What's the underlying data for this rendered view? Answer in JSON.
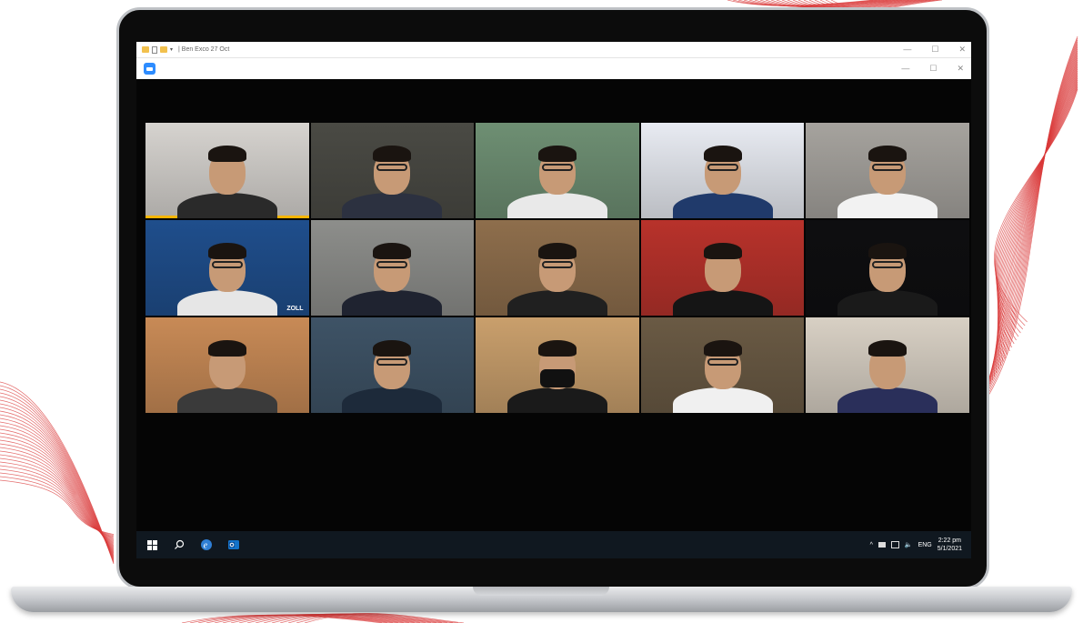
{
  "explorer": {
    "path_text": "| Ben Exco 27 Oct",
    "minimize": "—",
    "maximize": "☐",
    "close": "✕"
  },
  "zoom": {
    "minimize": "—",
    "maximize": "☐",
    "close": "✕"
  },
  "participants": [
    {
      "bg": "#d6d3cf",
      "shirt": "#2a2a2a",
      "glasses": false,
      "mask": false,
      "active": true
    },
    {
      "bg": "#4a4a44",
      "shirt": "#2c3140",
      "glasses": true,
      "mask": false,
      "active": false
    },
    {
      "bg": "#6e8f73",
      "shirt": "#e9e9e9",
      "glasses": true,
      "mask": false,
      "active": false
    },
    {
      "bg": "#e8ebf2",
      "shirt": "#203a6b",
      "glasses": true,
      "mask": false,
      "active": false
    },
    {
      "bg": "#a6a39e",
      "shirt": "#f2f2f2",
      "glasses": true,
      "mask": false,
      "active": false
    },
    {
      "bg": "#1f4e8c",
      "shirt": "#e6e6e6",
      "glasses": true,
      "mask": false,
      "active": false,
      "label": "ZOLL"
    },
    {
      "bg": "#8d8e8b",
      "shirt": "#1f2330",
      "glasses": true,
      "mask": false,
      "active": false
    },
    {
      "bg": "#8e6e4c",
      "shirt": "#202020",
      "glasses": true,
      "mask": false,
      "active": false
    },
    {
      "bg": "#b8322b",
      "shirt": "#151515",
      "glasses": false,
      "mask": false,
      "active": false
    },
    {
      "bg": "#0e0e10",
      "shirt": "#1a1a1a",
      "glasses": true,
      "mask": false,
      "active": false
    },
    {
      "bg": "#c88a56",
      "shirt": "#3a3a3a",
      "glasses": false,
      "mask": false,
      "active": false
    },
    {
      "bg": "#3e5366",
      "shirt": "#1d2a3a",
      "glasses": true,
      "mask": false,
      "active": false
    },
    {
      "bg": "#c99f6c",
      "shirt": "#1a1a1a",
      "glasses": false,
      "mask": true,
      "active": false
    },
    {
      "bg": "#6a5a44",
      "shirt": "#f0f0f0",
      "glasses": true,
      "mask": false,
      "active": false
    },
    {
      "bg": "#d8d0c4",
      "shirt": "#2a2f5a",
      "glasses": false,
      "mask": false,
      "active": false
    }
  ],
  "taskbar": {
    "tray_lang": "ENG",
    "time": "2:22 pm",
    "date": "5/1/2021",
    "tray_chevron": "^"
  },
  "colors": {
    "accent_wave": "#d93a3a",
    "zoom_blue": "#2d8cff",
    "active_speaker": "#f7b500"
  }
}
